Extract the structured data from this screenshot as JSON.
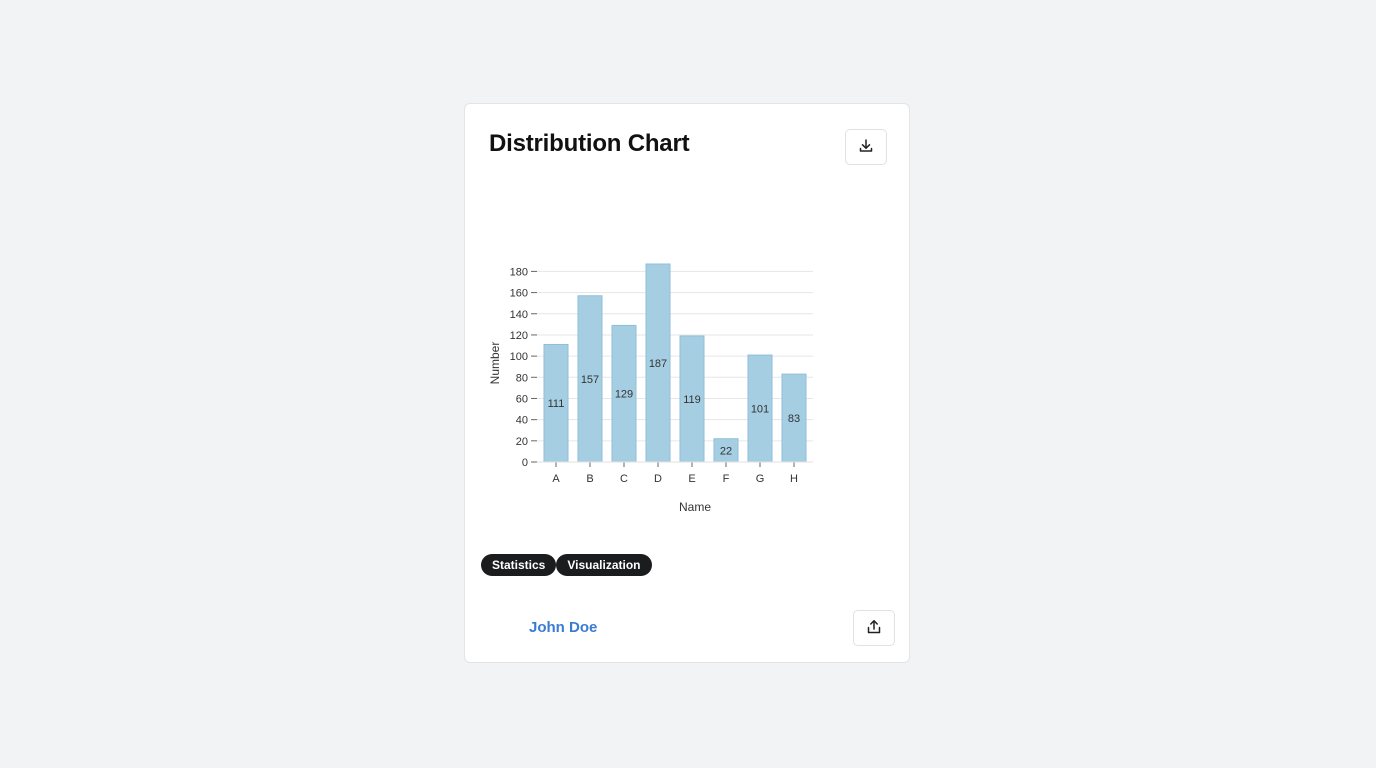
{
  "card": {
    "title": "Distribution Chart",
    "download_icon": "download-icon",
    "share_icon": "share-icon",
    "tags": [
      "Statistics",
      "Visualization"
    ],
    "author": "John Doe"
  },
  "colors": {
    "bar_fill": "#a6cee3",
    "bar_stroke": "#8fbfd8",
    "tag_bg": "#1b1c1e",
    "author_link": "#3a7bd5"
  },
  "chart_data": {
    "type": "bar",
    "categories": [
      "A",
      "B",
      "C",
      "D",
      "E",
      "F",
      "G",
      "H"
    ],
    "values": [
      111,
      157,
      129,
      187,
      119,
      22,
      101,
      83
    ],
    "title": "",
    "xlabel": "Name",
    "ylabel": "Number",
    "ylim": [
      0,
      187
    ],
    "yticks": [
      0,
      20,
      40,
      60,
      80,
      100,
      120,
      140,
      160,
      180
    ],
    "grid": true,
    "data_labels": true
  }
}
